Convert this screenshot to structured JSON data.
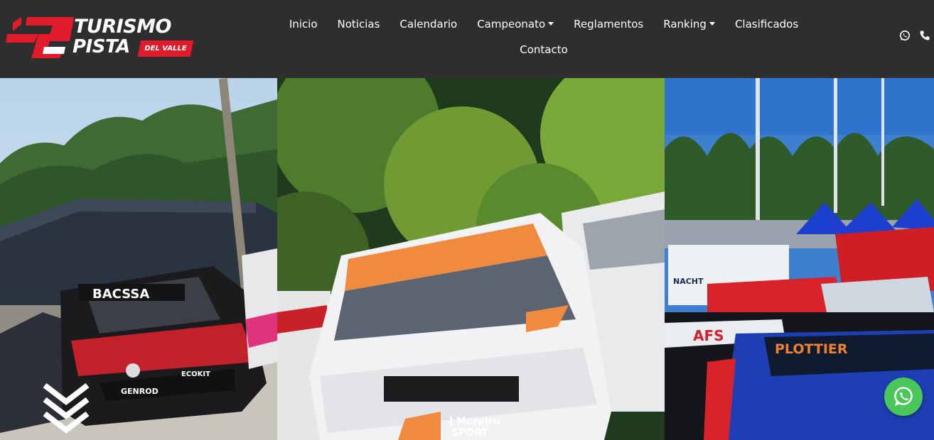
{
  "brand": {
    "line1": "TURISMO",
    "line2": "PISTA",
    "badge": "DEL VALLE",
    "accent": "#e11b2a"
  },
  "nav": {
    "row1": [
      {
        "label": "Inicio",
        "dropdown": false
      },
      {
        "label": "Noticias",
        "dropdown": false
      },
      {
        "label": "Calendario",
        "dropdown": false
      },
      {
        "label": "Campeonato",
        "dropdown": true
      },
      {
        "label": "Reglamentos",
        "dropdown": false
      },
      {
        "label": "Ranking",
        "dropdown": true
      },
      {
        "label": "Clasificados",
        "dropdown": false
      }
    ],
    "row2": [
      {
        "label": "Contacto",
        "dropdown": false
      }
    ]
  },
  "social": {
    "icons": [
      "whatsapp-icon",
      "phone-icon"
    ]
  },
  "hero": {
    "panels": [
      {
        "name": "left",
        "car_sponsor": "BACSSA",
        "car_plate": "GENROD",
        "side": "ECOKIT"
      },
      {
        "name": "center",
        "hood_text": "J Moreiro",
        "hood_text2": "SPORT"
      },
      {
        "name": "right",
        "banner": "PLOTTIER",
        "sign": "AFS",
        "truck": "NACHT"
      }
    ],
    "scroll_icon": "chevrons-down-icon",
    "float_button_icon": "whatsapp-icon",
    "float_button_color": "#4bc65a"
  }
}
